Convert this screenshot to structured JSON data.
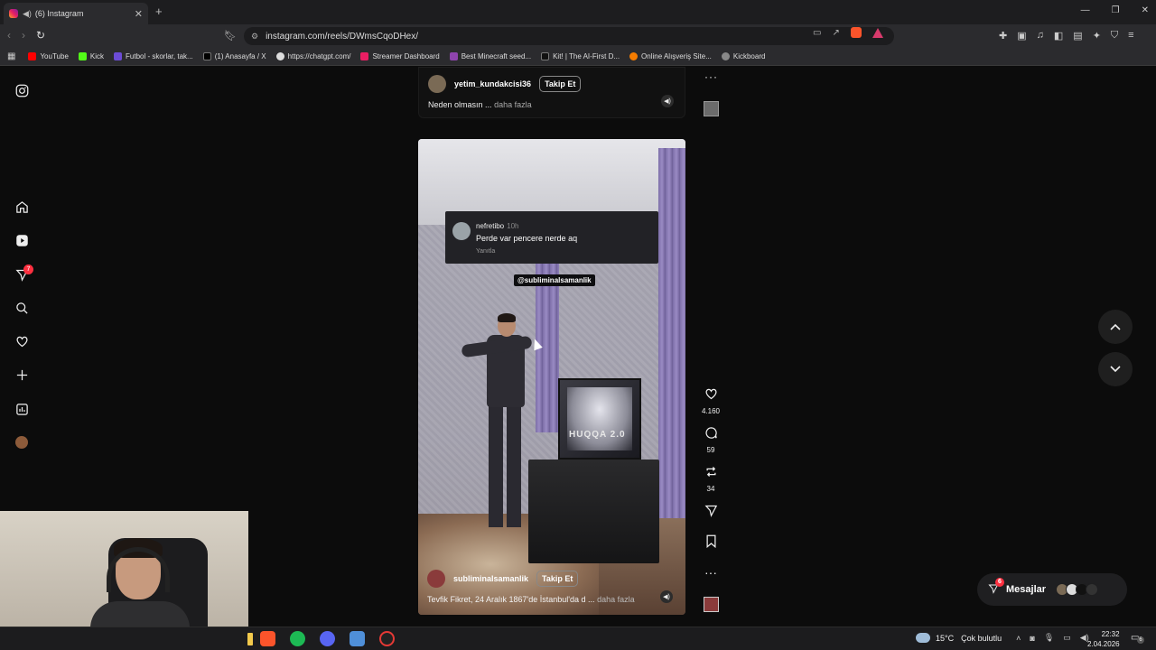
{
  "browser": {
    "tab_title": "(6) Instagram",
    "url": "instagram.com/reels/DWmsCqoDHex/",
    "bookmarks": [
      {
        "label": "YouTube",
        "color": "#ff0000"
      },
      {
        "label": "Kick",
        "color": "#53fc18"
      },
      {
        "label": "Futbol - skorlar, tak...",
        "color": "#6c4cd6"
      },
      {
        "label": "(1) Anasayfa / X",
        "color": "#000000"
      },
      {
        "label": "https://chatgpt.com/",
        "color": "#dddddd"
      },
      {
        "label": "Streamer Dashboard",
        "color": "#e91e63"
      },
      {
        "label": "Best Minecraft seed...",
        "color": "#8e44ad"
      },
      {
        "label": "Kit! | The AI-First D...",
        "color": "#111111"
      },
      {
        "label": "Online Alışveriş Site...",
        "color": "#f57c00"
      },
      {
        "label": "Kickboard",
        "color": "#888888"
      }
    ]
  },
  "sidebar": {
    "notifications_badge": "7"
  },
  "prev_reel": {
    "username": "yetim_kundakcisi36",
    "follow_label": "Takip Et",
    "caption": "Neden olmasın ...",
    "more_label": "daha fazla"
  },
  "reel": {
    "comment_user": "nefretibo",
    "comment_time": "10h",
    "comment_text": "Perde var pencere nerde aq",
    "comment_reply": "Yanıtla",
    "mention": "@subliminalsamanlik",
    "tv_text": "HUQQA 2.0",
    "username": "subliminalsamanlik",
    "follow_label": "Takip Et",
    "caption": "Tevfik Fikret, 24 Aralık 1867'de İstanbul'da d ...",
    "more_label": "daha fazla",
    "likes": "4.160",
    "comments": "59",
    "reposts": "34"
  },
  "messages": {
    "label": "Mesajlar",
    "badge": "6"
  },
  "taskbar": {
    "temp": "15°C",
    "weather": "Çok bulutlu",
    "time": "22:32",
    "date": "2.04.2026",
    "notif_badge": "6"
  },
  "colors": {
    "accent_red": "#ff3040",
    "background": "#0c0c0c"
  }
}
